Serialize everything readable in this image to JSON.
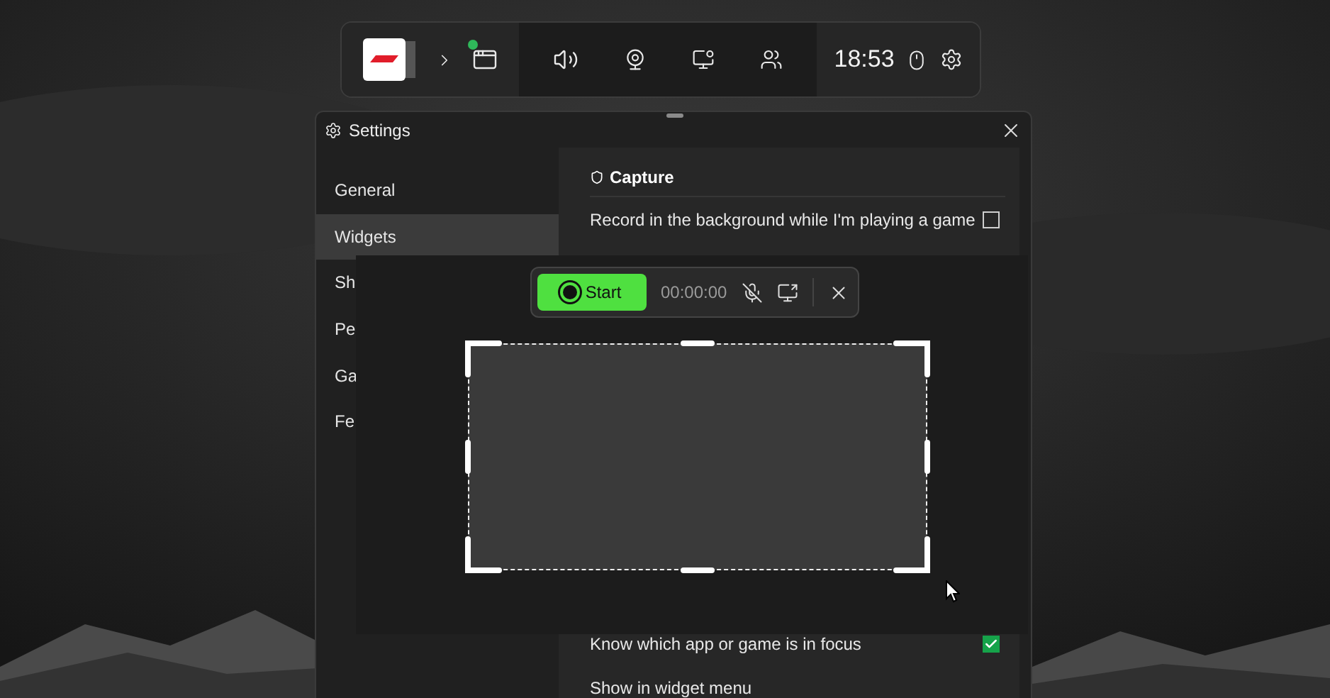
{
  "game_bar": {
    "capture_active": true,
    "time": "18:53"
  },
  "settings": {
    "title": "Settings",
    "sidebar": [
      {
        "label": "General",
        "selected": false
      },
      {
        "label": "Widgets",
        "selected": true
      },
      {
        "label": "Sh",
        "selected": false
      },
      {
        "label": "Pe",
        "selected": false
      },
      {
        "label": "Ga",
        "selected": false
      },
      {
        "label": "Fe",
        "selected": false
      }
    ],
    "section_title": "Capture",
    "rows_above": [
      {
        "label": "Record in the background while I'm playing a game",
        "checked": false
      }
    ],
    "rows_below": [
      {
        "label": "Know which app or game is in focus",
        "checked": true
      },
      {
        "label": "Show in widget menu"
      }
    ]
  },
  "capture_toolbar": {
    "start_label": "Start",
    "timer": "00:00:00",
    "mic_muted": true
  }
}
